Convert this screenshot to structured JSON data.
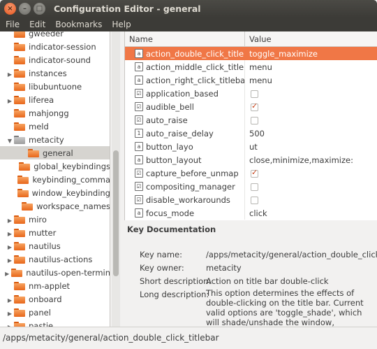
{
  "window": {
    "title": "Configuration Editor - general",
    "close_glyph": "×",
    "minimize_glyph": "–",
    "maximize_glyph": "□"
  },
  "menubar": [
    "File",
    "Edit",
    "Bookmarks",
    "Help"
  ],
  "tree": [
    {
      "label": "gweeder",
      "expander": "",
      "folder": "orange",
      "selected": false
    },
    {
      "label": "indicator-session",
      "expander": "",
      "folder": "orange",
      "selected": false
    },
    {
      "label": "indicator-sound",
      "expander": "",
      "folder": "orange",
      "selected": false
    },
    {
      "label": "instances",
      "expander": "▶",
      "folder": "orange",
      "selected": false
    },
    {
      "label": "libubuntuone",
      "expander": "",
      "folder": "orange",
      "selected": false
    },
    {
      "label": "liferea",
      "expander": "▶",
      "folder": "orange",
      "selected": false
    },
    {
      "label": "mahjongg",
      "expander": "",
      "folder": "orange",
      "selected": false
    },
    {
      "label": "meld",
      "expander": "",
      "folder": "orange",
      "selected": false
    },
    {
      "label": "metacity",
      "expander": "▼",
      "folder": "grey",
      "selected": false
    },
    {
      "label": "general",
      "expander": "",
      "folder": "orange",
      "selected": true,
      "child": true
    },
    {
      "label": "global_keybindings",
      "expander": "",
      "folder": "orange",
      "selected": false,
      "child": true
    },
    {
      "label": "keybinding_comma",
      "expander": "",
      "folder": "orange",
      "selected": false,
      "child": true
    },
    {
      "label": "window_keybinding",
      "expander": "",
      "folder": "orange",
      "selected": false,
      "child": true
    },
    {
      "label": "workspace_names",
      "expander": "",
      "folder": "orange",
      "selected": false,
      "child": true
    },
    {
      "label": "miro",
      "expander": "▶",
      "folder": "orange",
      "selected": false
    },
    {
      "label": "mutter",
      "expander": "▶",
      "folder": "orange",
      "selected": false
    },
    {
      "label": "nautilus",
      "expander": "▶",
      "folder": "orange",
      "selected": false
    },
    {
      "label": "nautilus-actions",
      "expander": "▶",
      "folder": "orange",
      "selected": false
    },
    {
      "label": "nautilus-open-termin",
      "expander": "▶",
      "folder": "orange",
      "selected": false
    },
    {
      "label": "nm-applet",
      "expander": "",
      "folder": "orange",
      "selected": false
    },
    {
      "label": "onboard",
      "expander": "▶",
      "folder": "orange",
      "selected": false
    },
    {
      "label": "panel",
      "expander": "▶",
      "folder": "orange",
      "selected": false
    },
    {
      "label": "pastie",
      "expander": "▶",
      "folder": "orange",
      "selected": false
    }
  ],
  "grid": {
    "header": {
      "name": "Name",
      "value": "Value"
    },
    "rows": [
      {
        "name": "action_double_click_titlebar",
        "type": "text",
        "icon_glyph": "a",
        "value": "toggle_maximize",
        "selected": true
      },
      {
        "name": "action_middle_click_titlebar",
        "type": "text",
        "icon_glyph": "a",
        "value": "menu"
      },
      {
        "name": "action_right_click_titlebar",
        "type": "text",
        "icon_glyph": "a",
        "value": "menu"
      },
      {
        "name": "application_based",
        "type": "bool",
        "icon_glyph": "☑",
        "checked": false
      },
      {
        "name": "audible_bell",
        "type": "bool",
        "icon_glyph": "☑",
        "checked": true
      },
      {
        "name": "auto_raise",
        "type": "bool",
        "icon_glyph": "☑",
        "checked": false
      },
      {
        "name": "auto_raise_delay",
        "type": "int",
        "icon_glyph": "1",
        "value": "500"
      },
      {
        "name": "button_layo",
        "type": "text",
        "icon_glyph": "a",
        "value": "ut"
      },
      {
        "name": "button_layout",
        "type": "text",
        "icon_glyph": "a",
        "value": "close,minimize,maximize:"
      },
      {
        "name": "capture_before_unmap",
        "type": "bool",
        "icon_glyph": "☑",
        "checked": true
      },
      {
        "name": "compositing_manager",
        "type": "bool",
        "icon_glyph": "☑",
        "checked": false
      },
      {
        "name": "disable_workarounds",
        "type": "bool",
        "icon_glyph": "☑",
        "checked": false
      },
      {
        "name": "focus_mode",
        "type": "text",
        "icon_glyph": "a",
        "value": "click"
      }
    ]
  },
  "key_documentation": {
    "title": "Key Documentation",
    "key_name_label": "Key name:",
    "key_name": "/apps/metacity/general/action_double_click_titlebar",
    "key_owner_label": "Key owner:",
    "key_owner": "metacity",
    "short_description_label": "Short description:",
    "short_description": "Action on title bar double-click",
    "long_description_label": "Long description:",
    "long_description": "This option determines the effects of double-clicking on the title bar. Current valid options are 'toggle_shade', which will shade/unshade the window, 'toggle_maximize' which will maximize/unmaximize the window,"
  },
  "statusbar": {
    "text": "/apps/metacity/general/action_double_click_titlebar"
  },
  "colors": {
    "selection": "#f07746",
    "titlebar": "#3c3b37",
    "close_button": "#e9541a",
    "folder": "#e8661a",
    "checkmark": "#c8431a"
  }
}
